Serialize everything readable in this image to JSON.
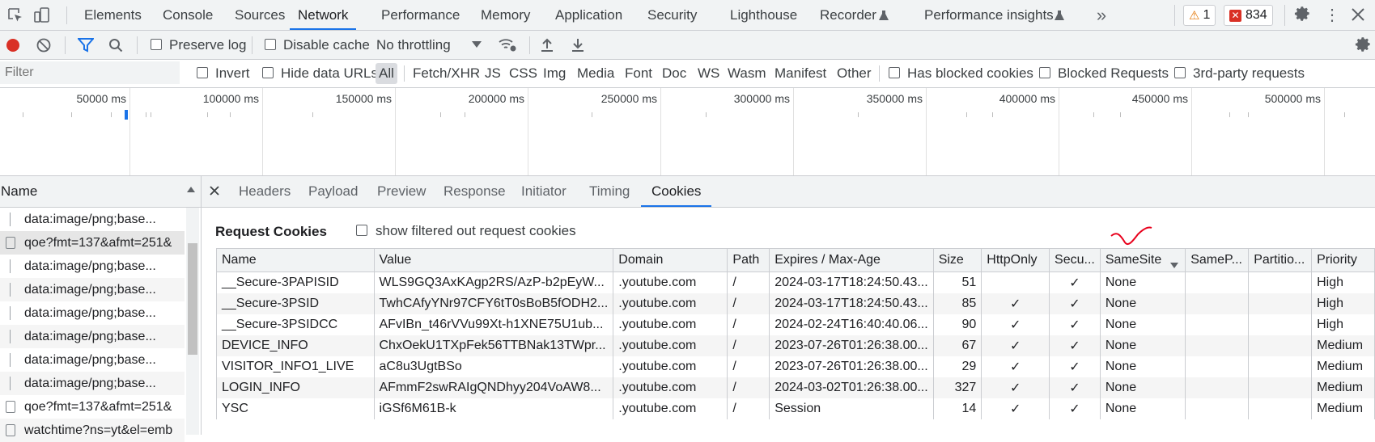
{
  "tabs": [
    "Elements",
    "Console",
    "Sources",
    "Network",
    "Performance",
    "Memory",
    "Application",
    "Security",
    "Lighthouse",
    "Recorder",
    "Performance insights"
  ],
  "badges": {
    "warnings": "1",
    "errors": "834"
  },
  "toolbar": {
    "preserve_log": "Preserve log",
    "disable_cache": "Disable cache",
    "throttling": "No throttling"
  },
  "filter": {
    "placeholder": "Filter",
    "invert": "Invert",
    "hide_data_urls": "Hide data URLs",
    "types": [
      "All",
      "Fetch/XHR",
      "JS",
      "CSS",
      "Img",
      "Media",
      "Font",
      "Doc",
      "WS",
      "Wasm",
      "Manifest",
      "Other"
    ],
    "has_blocked_cookies": "Has blocked cookies",
    "blocked_requests": "Blocked Requests",
    "third_party": "3rd-party requests"
  },
  "overview": {
    "ticks": [
      "50000 ms",
      "100000 ms",
      "150000 ms",
      "200000 ms",
      "250000 ms",
      "300000 ms",
      "350000 ms",
      "400000 ms",
      "450000 ms",
      "500000 ms"
    ]
  },
  "requests": {
    "header": "Name",
    "items": [
      "data:image/png;base...",
      "qoe?fmt=137&afmt=251&",
      "data:image/png;base...",
      "data:image/png;base...",
      "data:image/png;base...",
      "data:image/png;base...",
      "data:image/png;base...",
      "data:image/png;base...",
      "qoe?fmt=137&afmt=251&",
      "watchtime?ns=yt&el=emb"
    ]
  },
  "detail_tabs": [
    "Headers",
    "Payload",
    "Preview",
    "Response",
    "Initiator",
    "Timing",
    "Cookies"
  ],
  "cookies": {
    "section_title": "Request Cookies",
    "show_filtered": "show filtered out request cookies",
    "columns": [
      "Name",
      "Value",
      "Domain",
      "Path",
      "Expires / Max-Age",
      "Size",
      "HttpOnly",
      "Secu...",
      "SameSite",
      "SameP...",
      "Partitio...",
      "Priority"
    ],
    "rows": [
      [
        "__Secure-3PAPISID",
        "WLS9GQ3AxKAgp2RS/AzP-b2pEyW...",
        ".youtube.com",
        "/",
        "2024-03-17T18:24:50.43...",
        "51",
        "",
        "✓",
        "None",
        "",
        "",
        "High"
      ],
      [
        "__Secure-3PSID",
        "TwhCAfyYNr97CFY6tT0sBoB5fODH2...",
        ".youtube.com",
        "/",
        "2024-03-17T18:24:50.43...",
        "85",
        "✓",
        "✓",
        "None",
        "",
        "",
        "High"
      ],
      [
        "__Secure-3PSIDCC",
        "AFvIBn_t46rVVu99Xt-h1XNE75U1ub...",
        ".youtube.com",
        "/",
        "2024-02-24T16:40:40.06...",
        "90",
        "✓",
        "✓",
        "None",
        "",
        "",
        "High"
      ],
      [
        "DEVICE_INFO",
        "ChxOekU1TXpFek56TTBNak13TWpr...",
        ".youtube.com",
        "/",
        "2023-07-26T01:26:38.00...",
        "67",
        "✓",
        "✓",
        "None",
        "",
        "",
        "Medium"
      ],
      [
        "VISITOR_INFO1_LIVE",
        "aC8u3UgtBSo",
        ".youtube.com",
        "/",
        "2023-07-26T01:26:38.00...",
        "29",
        "✓",
        "✓",
        "None",
        "",
        "",
        "Medium"
      ],
      [
        "LOGIN_INFO",
        "AFmmF2swRAIgQNDhyy204VoAW8...",
        ".youtube.com",
        "/",
        "2024-03-02T01:26:38.00...",
        "327",
        "✓",
        "✓",
        "None",
        "",
        "",
        "Medium"
      ],
      [
        "YSC",
        "iGSf6M61B-k",
        ".youtube.com",
        "/",
        "Session",
        "14",
        "✓",
        "✓",
        "None",
        "",
        "",
        "Medium"
      ]
    ]
  },
  "colors": {
    "accent": "#1a73e8",
    "record": "#d93025",
    "annotation": "#e8001c"
  }
}
